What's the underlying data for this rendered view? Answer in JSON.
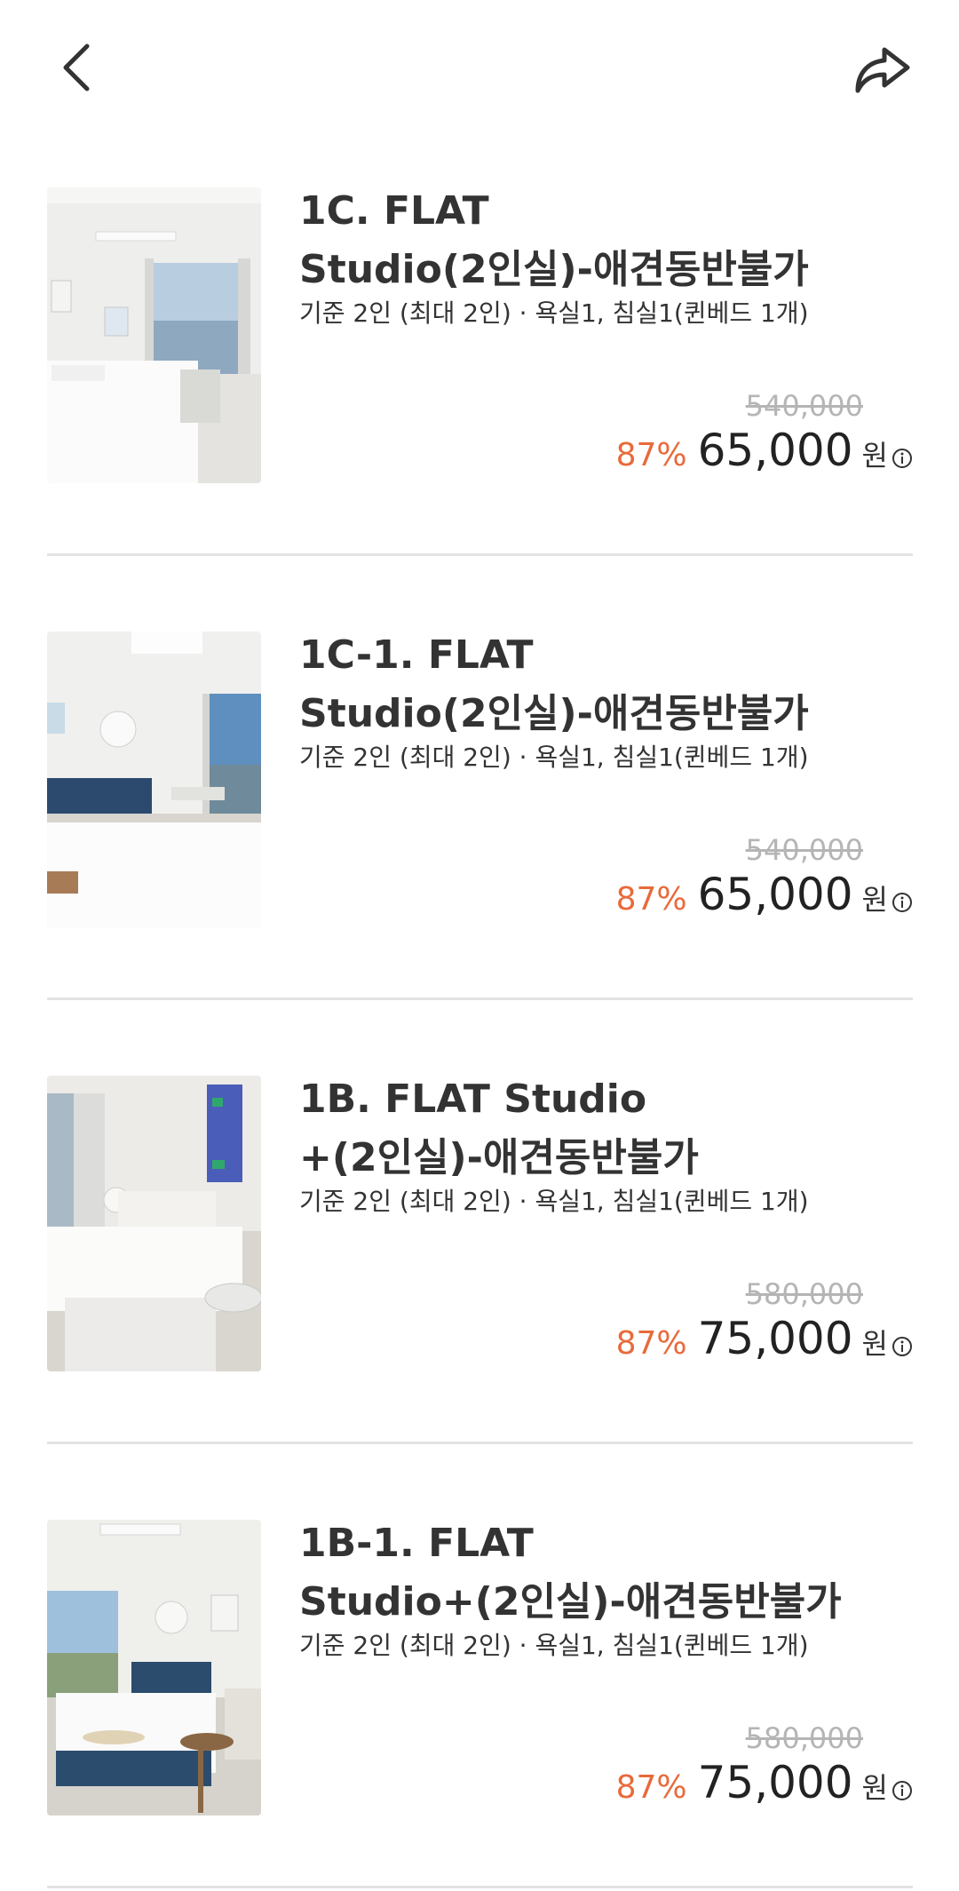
{
  "header": {
    "back_icon": "chevron-left-icon",
    "share_icon": "share-arrow-icon"
  },
  "rooms": [
    {
      "title_line1": "1C. FLAT",
      "title_line2": "Studio(2인실)-애견동반불가",
      "meta": "기준 2인 (최대 2인) · 욕실1, 침실1(퀸베드 1개)",
      "original_price": "540,000",
      "discount": "87%",
      "price": "65,000",
      "currency": "원",
      "photo": "room-photo-bed-window"
    },
    {
      "title_line1": "1C-1. FLAT",
      "title_line2": "Studio(2인실)-애견동반불가",
      "meta": "기준 2인 (최대 2인) · 욕실1, 침실1(퀸베드 1개)",
      "original_price": "540,000",
      "discount": "87%",
      "price": "65,000",
      "currency": "원",
      "photo": "room-photo-navy-headboard"
    },
    {
      "title_line1": "1B. FLAT Studio",
      "title_line2": "+(2인실)-애견동반불가",
      "meta": "기준 2인 (최대 2인) · 욕실1, 침실1(퀸베드 1개)",
      "original_price": "580,000",
      "discount": "87%",
      "price": "75,000",
      "currency": "원",
      "photo": "room-photo-white-bench"
    },
    {
      "title_line1": "1B-1. FLAT",
      "title_line2": "Studio+(2인실)-애견동반불가",
      "meta": "기준 2인 (최대 2인) · 욕실1, 침실1(퀸베드 1개)",
      "original_price": "580,000",
      "discount": "87%",
      "price": "75,000",
      "currency": "원",
      "photo": "room-photo-round-table"
    }
  ],
  "colors": {
    "discount": "#e86a3b",
    "original_price": "#b5b5b5",
    "divider": "#e3e3e3"
  }
}
